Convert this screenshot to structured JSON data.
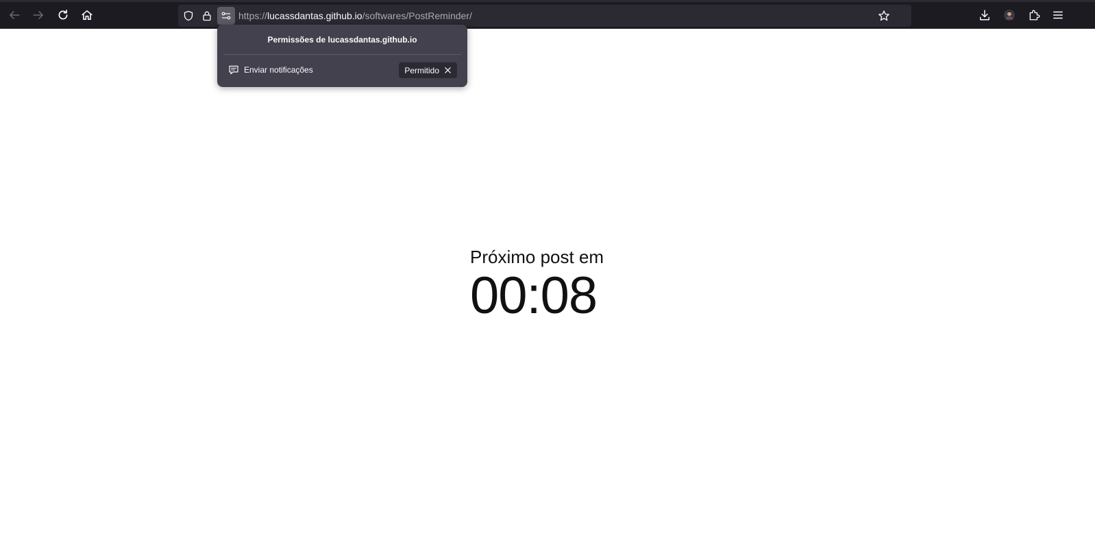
{
  "browser": {
    "url": {
      "scheme": "https://",
      "host": "lucassdantas.github.io",
      "path": "/softwares/PostReminder/"
    },
    "toolbar_icons": [
      "back-icon",
      "forward-icon",
      "reload-icon",
      "home-icon",
      "shield-icon",
      "lock-icon",
      "permissions-icon",
      "bookmark-star-icon",
      "download-icon",
      "account-avatar",
      "extensions-icon",
      "menu-icon"
    ],
    "colors": {
      "toolbar_bg": "#1c1b22",
      "urlbar_bg": "#2b2a33",
      "popup_bg": "#42414d",
      "text_light": "#fbfbfe"
    }
  },
  "permissions_popup": {
    "title": "Permissões de lucassdantas.github.io",
    "items": [
      {
        "label": "Enviar notificações",
        "state": "Permitido",
        "icon": "notification-icon"
      }
    ]
  },
  "page": {
    "label": "Próximo post em",
    "time": "00:08"
  }
}
